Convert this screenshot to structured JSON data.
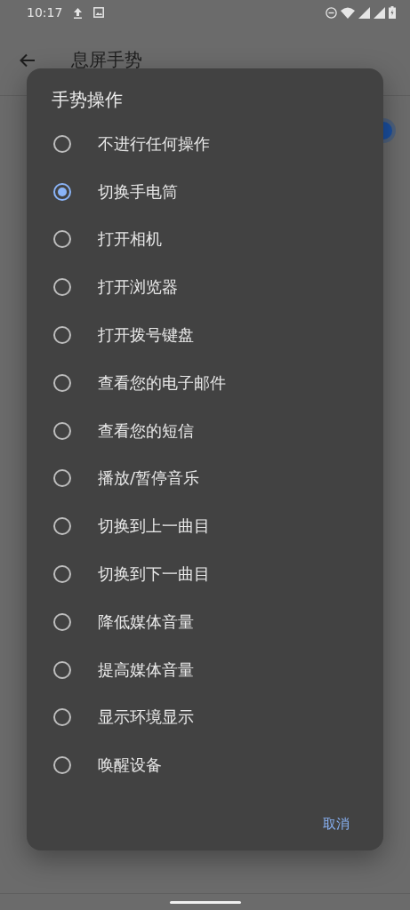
{
  "status_bar": {
    "time": "10:17"
  },
  "app_bar": {
    "title": "息屏手势"
  },
  "setting_switch": {
    "on": true
  },
  "dialog": {
    "title": "手势操作",
    "options": [
      {
        "label": "不进行任何操作",
        "selected": false
      },
      {
        "label": "切换手电筒",
        "selected": true
      },
      {
        "label": "打开相机",
        "selected": false
      },
      {
        "label": "打开浏览器",
        "selected": false
      },
      {
        "label": "打开拨号键盘",
        "selected": false
      },
      {
        "label": "查看您的电子邮件",
        "selected": false
      },
      {
        "label": "查看您的短信",
        "selected": false
      },
      {
        "label": "播放/暂停音乐",
        "selected": false
      },
      {
        "label": "切换到上一曲目",
        "selected": false
      },
      {
        "label": "切换到下一曲目",
        "selected": false
      },
      {
        "label": "降低媒体音量",
        "selected": false
      },
      {
        "label": "提高媒体音量",
        "selected": false
      },
      {
        "label": "显示环境显示",
        "selected": false
      },
      {
        "label": "唤醒设备",
        "selected": false
      }
    ],
    "buttons": [
      "取消"
    ]
  }
}
